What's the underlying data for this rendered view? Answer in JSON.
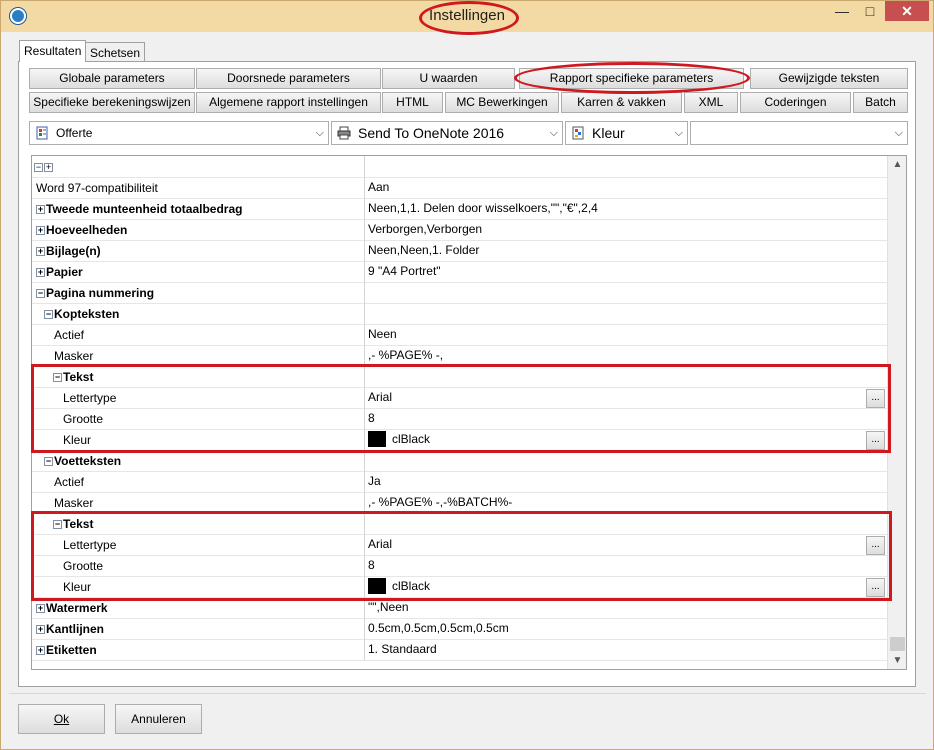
{
  "window": {
    "title": "Instellingen",
    "min_glyph": "—",
    "max_glyph": "□",
    "close_glyph": "✕"
  },
  "tabs": [
    {
      "label": "Resultaten"
    },
    {
      "label": "Schetsen"
    }
  ],
  "buttons_row1": [
    "Globale parameters",
    "Doorsnede parameters",
    "U waarden",
    "Rapport specifieke parameters",
    "Gewijzigde teksten"
  ],
  "buttons_row2": [
    "Specifieke berekeningswijzen",
    "Algemene rapport instellingen",
    "HTML",
    "MC Bewerkingen",
    "Karren & vakken",
    "XML",
    "Coderingen",
    "Batch"
  ],
  "combos": {
    "report": "Offerte",
    "printer": "Send To OneNote 2016",
    "color": "Kleur",
    "extra": ""
  },
  "grid": {
    "header": {
      "collapse": "−",
      "expand": "+"
    },
    "rows": [
      {
        "name": "Word 97-compatibiliteit",
        "value": "Aan"
      },
      {
        "name": "Tweede munteenheid totaalbedrag",
        "value": "Neen,1,1. Delen door wisselkoers,\"\",\"€\",2,4"
      },
      {
        "name": "Hoeveelheden",
        "value": "Verborgen,Verborgen"
      },
      {
        "name": "Bijlage(n)",
        "value": "Neen,Neen,1. Folder"
      },
      {
        "name": "Papier",
        "value": "9 \"A4 Portret\""
      },
      {
        "name": "Pagina nummering",
        "value": ""
      },
      {
        "name": "Kopteksten",
        "value": ""
      },
      {
        "name": "Actief",
        "value": "Neen"
      },
      {
        "name": "Masker",
        "value": ",- %PAGE% -,"
      },
      {
        "name": "Tekst",
        "value": ""
      },
      {
        "name": "Lettertype",
        "value": "Arial",
        "button": "..."
      },
      {
        "name": "Grootte",
        "value": "8"
      },
      {
        "name": "Kleur",
        "value": "clBlack",
        "button": "..."
      },
      {
        "name": "Voetteksten",
        "value": ""
      },
      {
        "name": "Actief",
        "value": "Ja"
      },
      {
        "name": "Masker",
        "value": ",- %PAGE% -,-%BATCH%-"
      },
      {
        "name": "Tekst",
        "value": ""
      },
      {
        "name": "Lettertype",
        "value": "Arial",
        "button": "..."
      },
      {
        "name": "Grootte",
        "value": "8"
      },
      {
        "name": "Kleur",
        "value": "clBlack",
        "button": "..."
      },
      {
        "name": "Watermerk",
        "value": "\"\",Neen"
      },
      {
        "name": "Kantlijnen",
        "value": "0.5cm,0.5cm,0.5cm,0.5cm"
      },
      {
        "name": "Etiketten",
        "value": "1. Standaard"
      }
    ]
  },
  "scrollbar": {
    "up": "▲",
    "down": "▼"
  },
  "footer": {
    "ok": "Ok",
    "cancel": "Annuleren"
  },
  "colors": {
    "highlight": "#d0191f",
    "titlebar": "#f3d9a4"
  }
}
